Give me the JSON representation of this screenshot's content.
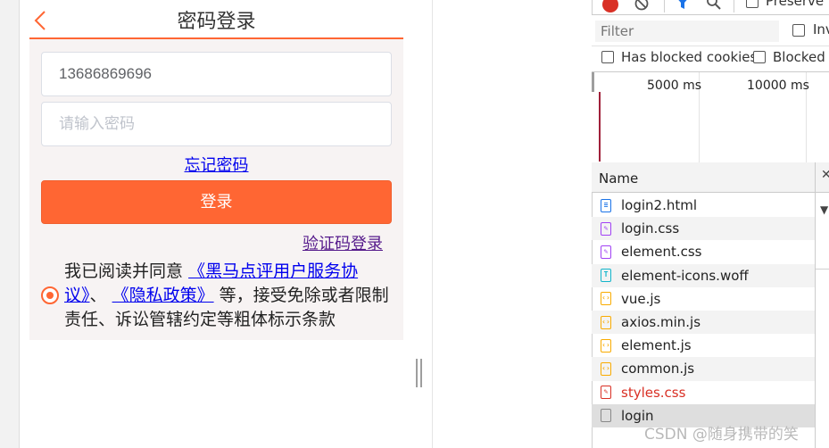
{
  "phone_app": {
    "title": "密码登录",
    "phone_input": {
      "value": "13686869696"
    },
    "password_input": {
      "placeholder": "请输入密码"
    },
    "forgot_link": "忘记密码",
    "login_button": "登录",
    "code_login_link": "验证码登录",
    "agreement": {
      "prefix": "我已阅读并同意",
      "service_link": "《黑马点评用户服务协议》",
      "separator": "、",
      "privacy_link": "《隐私政策》",
      "suffix": "等，接受免除或者限制责任、诉讼管辖约定等粗体标示条款",
      "checked": true
    },
    "colors": {
      "accent": "#ff6633",
      "link": "#0000ee",
      "visited_link": "#551a8b"
    }
  },
  "devtools": {
    "toolbar": {
      "preserve_log_label": "Preserve lo",
      "icons": [
        "record-icon",
        "clear-icon",
        "filter-icon",
        "search-icon"
      ]
    },
    "filter": {
      "placeholder": "Filter",
      "invert_label": "Inv"
    },
    "blocked_cookies_label": "Has blocked cookies",
    "blocked_requests_label": "Blocked R",
    "timeline_ticks": [
      "5000 ms",
      "10000 ms"
    ],
    "table": {
      "name_header": "Name",
      "rows": [
        {
          "name": "login2.html",
          "type": "document",
          "icon_color": "#1a73e8",
          "glyph": "≡"
        },
        {
          "name": "login.css",
          "type": "stylesheet",
          "icon_color": "#a142f4",
          "glyph": "✎"
        },
        {
          "name": "element.css",
          "type": "stylesheet",
          "icon_color": "#a142f4",
          "glyph": "✎"
        },
        {
          "name": "element-icons.woff",
          "type": "font",
          "icon_color": "#12b5cb",
          "glyph": "T"
        },
        {
          "name": "vue.js",
          "type": "script",
          "icon_color": "#f9ab00",
          "glyph": "‹›"
        },
        {
          "name": "axios.min.js",
          "type": "script",
          "icon_color": "#f9ab00",
          "glyph": "‹›"
        },
        {
          "name": "element.js",
          "type": "script",
          "icon_color": "#f9ab00",
          "glyph": "‹›"
        },
        {
          "name": "common.js",
          "type": "script",
          "icon_color": "#f9ab00",
          "glyph": "‹›"
        },
        {
          "name": "styles.css",
          "type": "stylesheet-error",
          "icon_color": "#d93025",
          "glyph": "✎",
          "error": true
        },
        {
          "name": "login",
          "type": "other",
          "icon_color": "#888888",
          "glyph": "",
          "selected": true
        }
      ]
    }
  },
  "watermark": "CSDN @随身携带的笑"
}
